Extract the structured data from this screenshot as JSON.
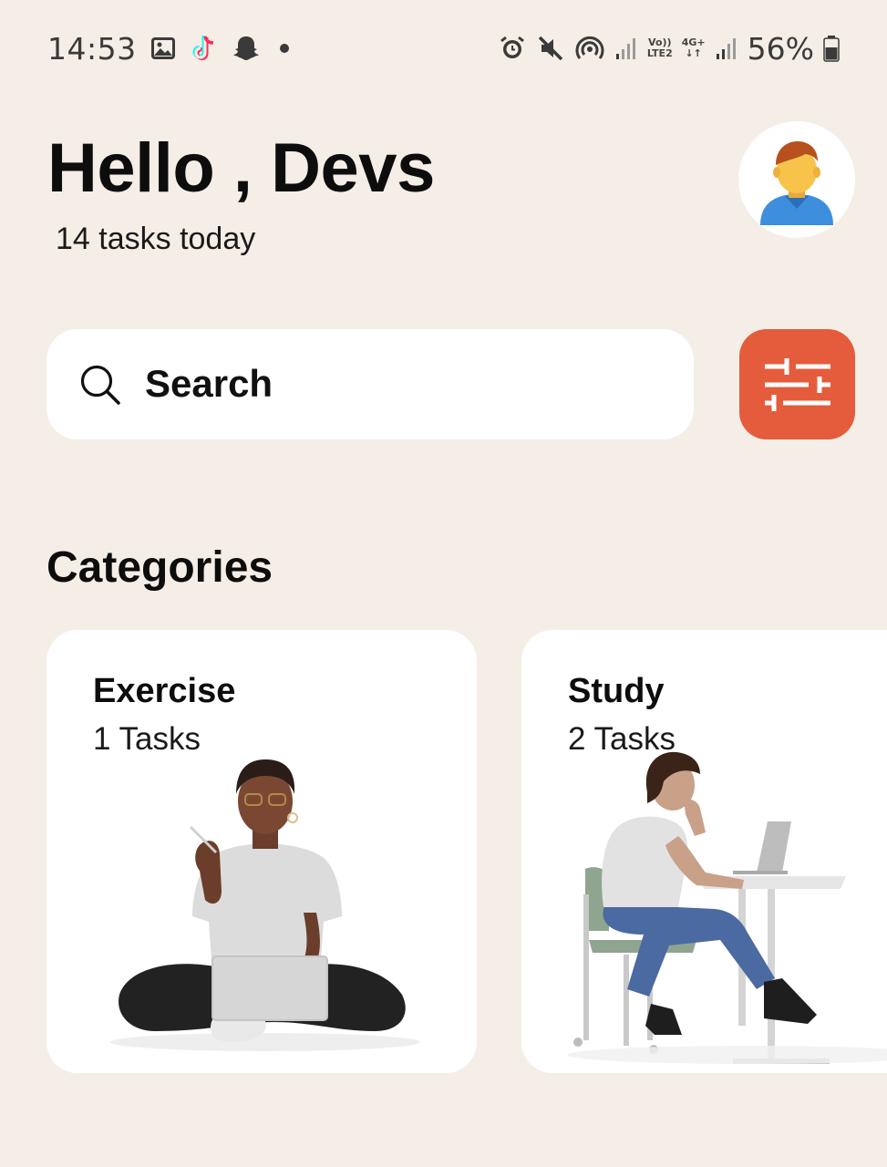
{
  "status_bar": {
    "time": "14:53",
    "left_icons": [
      "gallery-icon",
      "tiktok-icon",
      "snapchat-icon",
      "dot-icon"
    ],
    "right_icons": [
      "alarm-icon",
      "mute-icon",
      "hotspot-icon",
      "signal-icon",
      "volte-icon",
      "4g-icon",
      "signal-icon",
      "battery-icon"
    ],
    "volte_label": "Vo))\nLTE2",
    "network_label": "4G+\n↓↑",
    "battery_percent": "56%"
  },
  "header": {
    "greeting": "Hello , Devs",
    "subtitle": "14 tasks today",
    "avatar_icon": "user-avatar-icon"
  },
  "search": {
    "placeholder": "Search",
    "icon": "search-icon",
    "filter_icon": "sliders-icon"
  },
  "categories": {
    "title": "Categories",
    "items": [
      {
        "name": "Exercise",
        "count": "1 Tasks",
        "illustration": "person-sitting-with-laptop"
      },
      {
        "name": "Study",
        "count": "2 Tasks",
        "illustration": "person-at-desk-with-laptop"
      }
    ]
  },
  "colors": {
    "background": "#F5EEE6",
    "card": "#FFFFFF",
    "accent": "#E55C3C",
    "text": "#0D0D0D"
  }
}
